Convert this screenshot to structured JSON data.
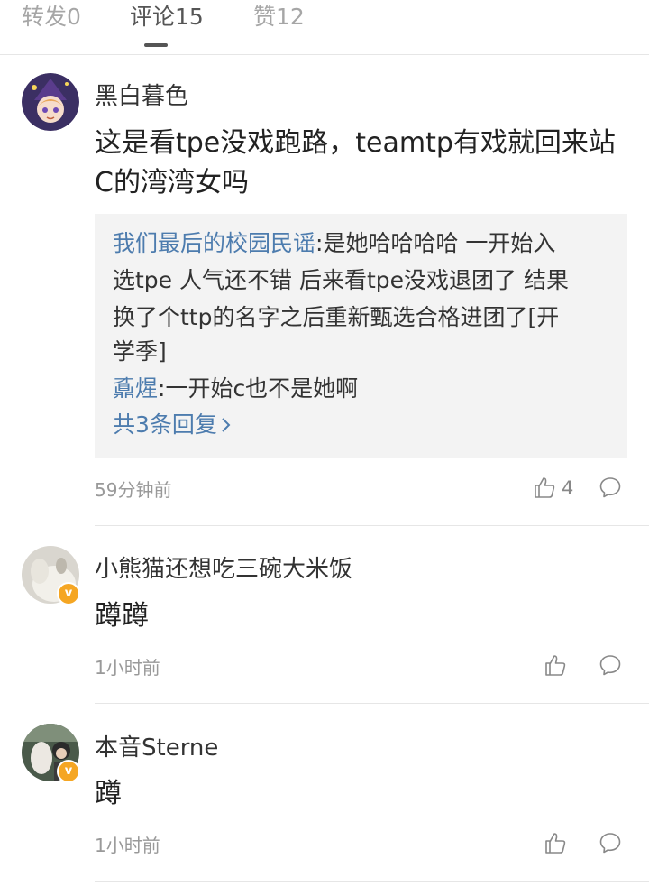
{
  "tabs": [
    {
      "label": "转发0"
    },
    {
      "label": "评论15"
    },
    {
      "label": "赞12"
    }
  ],
  "comments": [
    {
      "username": "黑白暮色",
      "text_line1": "这是看tpe没戏跑路，teamtp有戏就回来站",
      "text_line2": "C的湾湾女吗",
      "replies": {
        "reply1_user": "我们最后的校园民谣",
        "reply1_line1": ":是她哈哈哈哈 一开始入",
        "reply1_line2": "选tpe 人气还不错 后来看tpe没戏退团了 结果",
        "reply1_line3": "换了个ttp的名字之后重新甄选合格进团了[开",
        "reply1_line4": "学季]",
        "reply2_user": "鼒煋",
        "reply2_text": ":一开始c也不是她啊",
        "more_label": "共3条回复",
        "more_icon": "chevron-right-icon"
      },
      "time": "59分钟前",
      "likes": "4"
    },
    {
      "username": "小熊猫还想吃三碗大米饭",
      "text": "蹲蹲",
      "time": "1小时前",
      "verified": true
    },
    {
      "username": "本音Sterne",
      "text": "蹲",
      "time": "1小时前",
      "verified": true
    }
  ],
  "colors": {
    "link_blue": "#4d7cae",
    "badge_orange": "#f5a623",
    "quote_bg": "#f3f3f3"
  },
  "icons": {
    "like": "thumbs-up-icon",
    "reply": "comment-bubble-icon",
    "verified": "verified-badge-icon"
  }
}
